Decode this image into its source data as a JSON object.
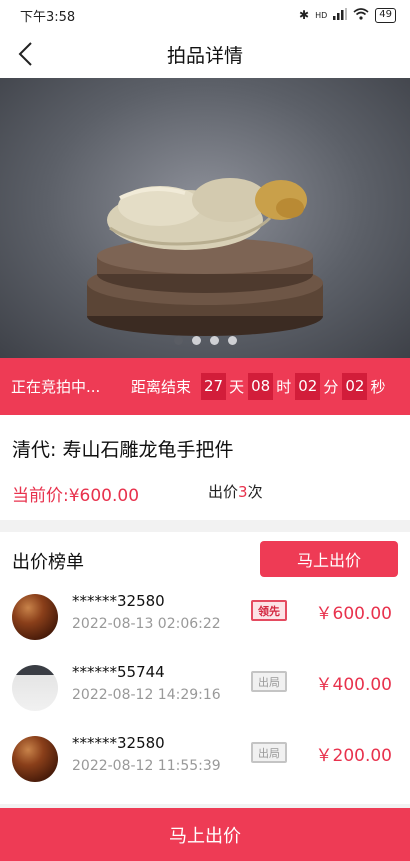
{
  "status_bar": {
    "time": "下午3:58",
    "signal": "HD",
    "battery": "49"
  },
  "nav": {
    "title": "拍品详情",
    "back_icon": "back-arrow-icon"
  },
  "carousel": {
    "count": 4,
    "active": 0
  },
  "countdown": {
    "status": "正在竞拍中...",
    "label": "距离结束",
    "days": "27",
    "days_unit": "天",
    "hours": "08",
    "hours_unit": "时",
    "minutes": "02",
    "minutes_unit": "分",
    "seconds": "02",
    "seconds_unit": "秒"
  },
  "item": {
    "title": "清代: 寿山石雕龙龟手把件",
    "price_label": "当前价: ",
    "price": "¥600.00",
    "bid_count_prefix": "出价",
    "bid_count": "3",
    "bid_count_suffix": "次"
  },
  "bids": {
    "title": "出价榜单",
    "bid_button": "马上出价",
    "rows": [
      {
        "name": "******32580",
        "time": "2022-08-13 02:06:22",
        "badge": "领先",
        "amount": "￥600.00"
      },
      {
        "name": "******55744",
        "time": "2022-08-12 14:29:16",
        "badge": "出局",
        "amount": "￥400.00"
      },
      {
        "name": "******32580",
        "time": "2022-08-12 11:55:39",
        "badge": "出局",
        "amount": "￥200.00"
      }
    ]
  },
  "bottom_button": "马上出价",
  "colors": {
    "accent": "#ee3b55",
    "accent_dark": "#d21d3a",
    "price": "#e8324d"
  }
}
